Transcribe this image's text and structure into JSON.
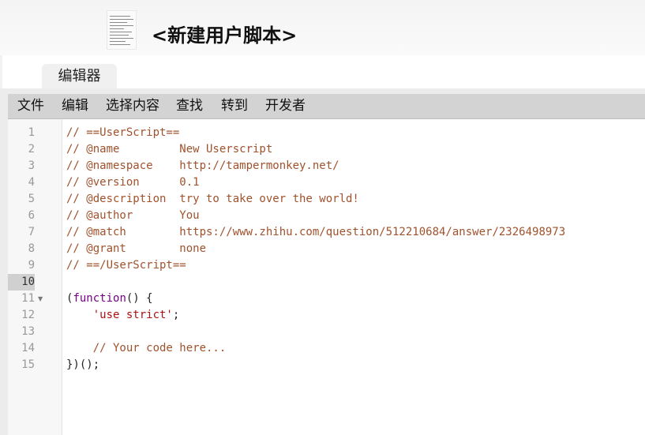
{
  "header": {
    "title": "<新建用户脚本>"
  },
  "tabs": [
    {
      "label": "编辑器"
    }
  ],
  "menu": [
    {
      "label": "文件"
    },
    {
      "label": "编辑"
    },
    {
      "label": "选择内容"
    },
    {
      "label": "查找"
    },
    {
      "label": "转到"
    },
    {
      "label": "开发者"
    }
  ],
  "editor": {
    "active_line": 10,
    "lines": [
      {
        "num": "1",
        "comment": "// ==UserScript=="
      },
      {
        "num": "2",
        "comment": "// @name         New Userscript"
      },
      {
        "num": "3",
        "comment": "// @namespace    http://tampermonkey.net/"
      },
      {
        "num": "4",
        "comment": "// @version      0.1"
      },
      {
        "num": "5",
        "comment": "// @description  try to take over the world!"
      },
      {
        "num": "6",
        "comment": "// @author       You"
      },
      {
        "num": "7",
        "comment": "// @match        https://www.zhihu.com/question/512210684/answer/2326498973"
      },
      {
        "num": "8",
        "comment": "// @grant        none"
      },
      {
        "num": "9",
        "comment": "// ==/UserScript=="
      },
      {
        "num": "10"
      },
      {
        "num": "11",
        "open": "(",
        "keyword": "function",
        "rest": "() {"
      },
      {
        "num": "12",
        "indent": "    ",
        "string": "'use strict'",
        "rest": ";"
      },
      {
        "num": "13"
      },
      {
        "num": "14",
        "indent": "    ",
        "comment": "// Your code here..."
      },
      {
        "num": "15",
        "rest": "})();"
      }
    ]
  },
  "colors": {
    "comment": "#a0522d",
    "keyword": "#770088",
    "string": "#aa1111",
    "menubar": "#d3d3d3"
  }
}
